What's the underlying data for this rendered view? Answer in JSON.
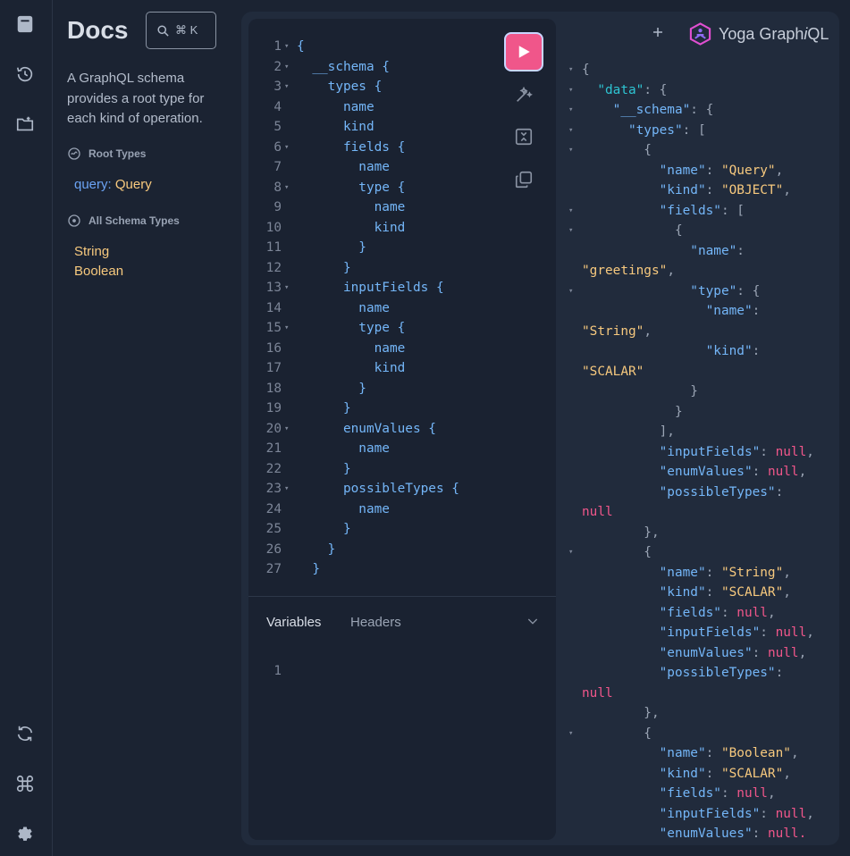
{
  "rail": {
    "icons": [
      "docs-book-icon",
      "history-icon",
      "folder-plus-icon",
      "refresh-icon",
      "command-icon",
      "settings-gear-icon"
    ]
  },
  "docs": {
    "title": "Docs",
    "search_shortcut": "⌘ K",
    "description": "A GraphQL schema provides a root type for each kind of operation.",
    "root_types_heading": "Root Types",
    "root_type_field": "query",
    "root_type_colon": ":",
    "root_type_name": "Query",
    "all_types_heading": "All Schema Types",
    "types": [
      "String",
      "Boolean"
    ]
  },
  "editor": {
    "lines": [
      {
        "n": "1",
        "fold": true,
        "code": "{"
      },
      {
        "n": "2",
        "fold": true,
        "code": "  __schema {"
      },
      {
        "n": "3",
        "fold": true,
        "code": "    types {"
      },
      {
        "n": "4",
        "fold": false,
        "code": "      name"
      },
      {
        "n": "5",
        "fold": false,
        "code": "      kind"
      },
      {
        "n": "6",
        "fold": true,
        "code": "      fields {"
      },
      {
        "n": "7",
        "fold": false,
        "code": "        name"
      },
      {
        "n": "8",
        "fold": true,
        "code": "        type {"
      },
      {
        "n": "9",
        "fold": false,
        "code": "          name"
      },
      {
        "n": "10",
        "fold": false,
        "code": "          kind"
      },
      {
        "n": "11",
        "fold": false,
        "code": "        }"
      },
      {
        "n": "12",
        "fold": false,
        "code": "      }"
      },
      {
        "n": "13",
        "fold": true,
        "code": "      inputFields {"
      },
      {
        "n": "14",
        "fold": false,
        "code": "        name"
      },
      {
        "n": "15",
        "fold": true,
        "code": "        type {"
      },
      {
        "n": "16",
        "fold": false,
        "code": "          name"
      },
      {
        "n": "17",
        "fold": false,
        "code": "          kind"
      },
      {
        "n": "18",
        "fold": false,
        "code": "        }"
      },
      {
        "n": "19",
        "fold": false,
        "code": "      }"
      },
      {
        "n": "20",
        "fold": true,
        "code": "      enumValues {"
      },
      {
        "n": "21",
        "fold": false,
        "code": "        name"
      },
      {
        "n": "22",
        "fold": false,
        "code": "      }"
      },
      {
        "n": "23",
        "fold": true,
        "code": "      possibleTypes {"
      },
      {
        "n": "24",
        "fold": false,
        "code": "        name"
      },
      {
        "n": "25",
        "fold": false,
        "code": "      }"
      },
      {
        "n": "26",
        "fold": false,
        "code": "    }"
      },
      {
        "n": "27",
        "fold": false,
        "code": "  }"
      }
    ],
    "variables_tab": "Variables",
    "headers_tab": "Headers",
    "variables_line_number": "1",
    "fold_glyph": "▾"
  },
  "header": {
    "logo_prefix": "Yoga Graph",
    "logo_italic": "i",
    "logo_suffix": "QL"
  },
  "result": {
    "lines": [
      {
        "fold": true,
        "segs": [
          [
            "p",
            "{"
          ]
        ]
      },
      {
        "fold": true,
        "segs": [
          [
            "p",
            "  "
          ],
          [
            "kd",
            "\"data\""
          ],
          [
            "p",
            ": {"
          ]
        ]
      },
      {
        "fold": true,
        "segs": [
          [
            "p",
            "    "
          ],
          [
            "k",
            "\"__schema\""
          ],
          [
            "p",
            ": {"
          ]
        ]
      },
      {
        "fold": true,
        "segs": [
          [
            "p",
            "      "
          ],
          [
            "k",
            "\"types\""
          ],
          [
            "p",
            ": ["
          ]
        ]
      },
      {
        "fold": true,
        "segs": [
          [
            "p",
            "        {"
          ]
        ]
      },
      {
        "fold": false,
        "segs": [
          [
            "p",
            "          "
          ],
          [
            "k",
            "\"name\""
          ],
          [
            "p",
            ": "
          ],
          [
            "s",
            "\"Query\""
          ],
          [
            "p",
            ","
          ]
        ]
      },
      {
        "fold": false,
        "segs": [
          [
            "p",
            "          "
          ],
          [
            "k",
            "\"kind\""
          ],
          [
            "p",
            ": "
          ],
          [
            "s",
            "\"OBJECT\""
          ],
          [
            "p",
            ","
          ]
        ]
      },
      {
        "fold": true,
        "segs": [
          [
            "p",
            "          "
          ],
          [
            "k",
            "\"fields\""
          ],
          [
            "p",
            ": ["
          ]
        ]
      },
      {
        "fold": true,
        "segs": [
          [
            "p",
            "            {"
          ]
        ]
      },
      {
        "fold": false,
        "segs": [
          [
            "p",
            "              "
          ],
          [
            "k",
            "\"name\""
          ],
          [
            "p",
            ":"
          ]
        ]
      },
      {
        "fold": false,
        "wrap": true,
        "segs": [
          [
            "s",
            "\"greetings\""
          ],
          [
            "p",
            ","
          ]
        ]
      },
      {
        "fold": true,
        "segs": [
          [
            "p",
            "              "
          ],
          [
            "k",
            "\"type\""
          ],
          [
            "p",
            ": {"
          ]
        ]
      },
      {
        "fold": false,
        "segs": [
          [
            "p",
            "                "
          ],
          [
            "k",
            "\"name\""
          ],
          [
            "p",
            ":"
          ]
        ]
      },
      {
        "fold": false,
        "wrap": true,
        "segs": [
          [
            "s",
            "\"String\""
          ],
          [
            "p",
            ","
          ]
        ]
      },
      {
        "fold": false,
        "segs": [
          [
            "p",
            "                "
          ],
          [
            "k",
            "\"kind\""
          ],
          [
            "p",
            ":"
          ]
        ]
      },
      {
        "fold": false,
        "wrap": true,
        "segs": [
          [
            "s",
            "\"SCALAR\""
          ]
        ]
      },
      {
        "fold": false,
        "segs": [
          [
            "p",
            "              }"
          ]
        ]
      },
      {
        "fold": false,
        "segs": [
          [
            "p",
            "            }"
          ]
        ]
      },
      {
        "fold": false,
        "segs": [
          [
            "p",
            "          ],"
          ]
        ]
      },
      {
        "fold": false,
        "segs": [
          [
            "p",
            "          "
          ],
          [
            "k",
            "\"inputFields\""
          ],
          [
            "p",
            ": "
          ],
          [
            "n",
            "null"
          ],
          [
            "p",
            ","
          ]
        ]
      },
      {
        "fold": false,
        "segs": [
          [
            "p",
            "          "
          ],
          [
            "k",
            "\"enumValues\""
          ],
          [
            "p",
            ": "
          ],
          [
            "n",
            "null"
          ],
          [
            "p",
            ","
          ]
        ]
      },
      {
        "fold": false,
        "segs": [
          [
            "p",
            "          "
          ],
          [
            "k",
            "\"possibleTypes\""
          ],
          [
            "p",
            ":"
          ]
        ]
      },
      {
        "fold": false,
        "wrap": true,
        "segs": [
          [
            "n",
            "null"
          ]
        ]
      },
      {
        "fold": false,
        "segs": [
          [
            "p",
            "        },"
          ]
        ]
      },
      {
        "fold": true,
        "segs": [
          [
            "p",
            "        {"
          ]
        ]
      },
      {
        "fold": false,
        "segs": [
          [
            "p",
            "          "
          ],
          [
            "k",
            "\"name\""
          ],
          [
            "p",
            ": "
          ],
          [
            "s",
            "\"String\""
          ],
          [
            "p",
            ","
          ]
        ]
      },
      {
        "fold": false,
        "segs": [
          [
            "p",
            "          "
          ],
          [
            "k",
            "\"kind\""
          ],
          [
            "p",
            ": "
          ],
          [
            "s",
            "\"SCALAR\""
          ],
          [
            "p",
            ","
          ]
        ]
      },
      {
        "fold": false,
        "segs": [
          [
            "p",
            "          "
          ],
          [
            "k",
            "\"fields\""
          ],
          [
            "p",
            ": "
          ],
          [
            "n",
            "null"
          ],
          [
            "p",
            ","
          ]
        ]
      },
      {
        "fold": false,
        "segs": [
          [
            "p",
            "          "
          ],
          [
            "k",
            "\"inputFields\""
          ],
          [
            "p",
            ": "
          ],
          [
            "n",
            "null"
          ],
          [
            "p",
            ","
          ]
        ]
      },
      {
        "fold": false,
        "segs": [
          [
            "p",
            "          "
          ],
          [
            "k",
            "\"enumValues\""
          ],
          [
            "p",
            ": "
          ],
          [
            "n",
            "null"
          ],
          [
            "p",
            ","
          ]
        ]
      },
      {
        "fold": false,
        "segs": [
          [
            "p",
            "          "
          ],
          [
            "k",
            "\"possibleTypes\""
          ],
          [
            "p",
            ":"
          ]
        ]
      },
      {
        "fold": false,
        "wrap": true,
        "segs": [
          [
            "n",
            "null"
          ]
        ]
      },
      {
        "fold": false,
        "segs": [
          [
            "p",
            "        },"
          ]
        ]
      },
      {
        "fold": true,
        "segs": [
          [
            "p",
            "        {"
          ]
        ]
      },
      {
        "fold": false,
        "segs": [
          [
            "p",
            "          "
          ],
          [
            "k",
            "\"name\""
          ],
          [
            "p",
            ": "
          ],
          [
            "s",
            "\"Boolean\""
          ],
          [
            "p",
            ","
          ]
        ]
      },
      {
        "fold": false,
        "segs": [
          [
            "p",
            "          "
          ],
          [
            "k",
            "\"kind\""
          ],
          [
            "p",
            ": "
          ],
          [
            "s",
            "\"SCALAR\""
          ],
          [
            "p",
            ","
          ]
        ]
      },
      {
        "fold": false,
        "segs": [
          [
            "p",
            "          "
          ],
          [
            "k",
            "\"fields\""
          ],
          [
            "p",
            ": "
          ],
          [
            "n",
            "null"
          ],
          [
            "p",
            ","
          ]
        ]
      },
      {
        "fold": false,
        "segs": [
          [
            "p",
            "          "
          ],
          [
            "k",
            "\"inputFields\""
          ],
          [
            "p",
            ": "
          ],
          [
            "n",
            "null"
          ],
          [
            "p",
            ","
          ]
        ]
      },
      {
        "fold": false,
        "segs": [
          [
            "p",
            "          "
          ],
          [
            "k",
            "\"enumValues\""
          ],
          [
            "p",
            ": "
          ],
          [
            "n",
            "null."
          ]
        ]
      }
    ]
  },
  "colors": {
    "background": "#1b2332",
    "panel": "#212b3c",
    "editor": "#1a2231",
    "run_button": "#f0568a",
    "keyword": "#74b6f8",
    "string": "#f7c97e",
    "null": "#f0568a",
    "data_key": "#2ec5d3"
  }
}
